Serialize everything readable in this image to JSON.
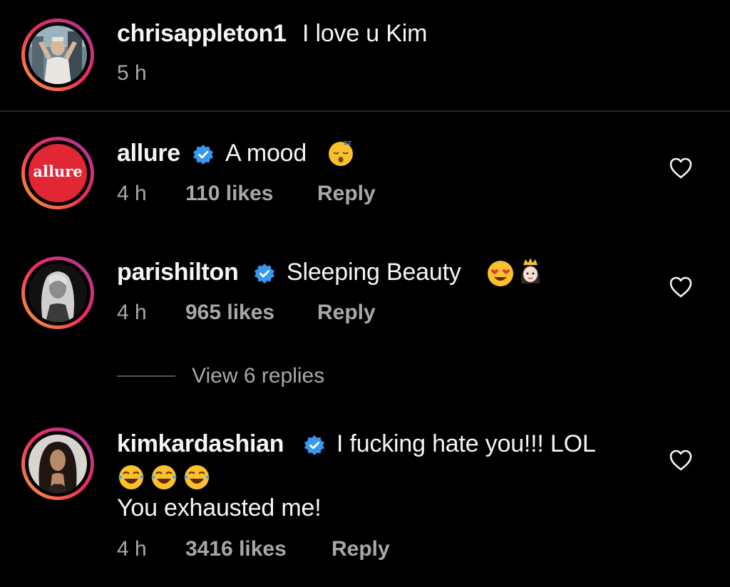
{
  "comments": [
    {
      "username": "chrisappleton1",
      "text": "I love u Kim",
      "time": "5 h",
      "verified": false
    },
    {
      "username": "allure",
      "text": "A mood",
      "emoji": "sleeping-face-emoji",
      "time": "4 h",
      "likes": "110 likes",
      "reply": "Reply",
      "verified": true,
      "avatar_text": "allure"
    },
    {
      "username": "parishilton",
      "text": "Sleeping Beauty",
      "emoji": [
        "heart-eyes-emoji",
        "princess-emoji"
      ],
      "time": "4 h",
      "likes": "965 likes",
      "reply": "Reply",
      "verified": true,
      "view_replies": "View 6 replies"
    },
    {
      "username": "kimkardashian",
      "text": "I fucking hate you!!! LOL",
      "emoji": [
        "tears-of-joy-emoji",
        "tears-of-joy-emoji",
        "tears-of-joy-emoji"
      ],
      "text2": "You exhausted me!",
      "time": "4 h",
      "likes": "3416 likes",
      "reply": "Reply",
      "verified": true
    }
  ],
  "colors": {
    "background": "#000000",
    "text": "#f5f5f5",
    "secondary": "#a8a8a8",
    "verified": "#3897f0",
    "allure_red": "#e32633"
  }
}
